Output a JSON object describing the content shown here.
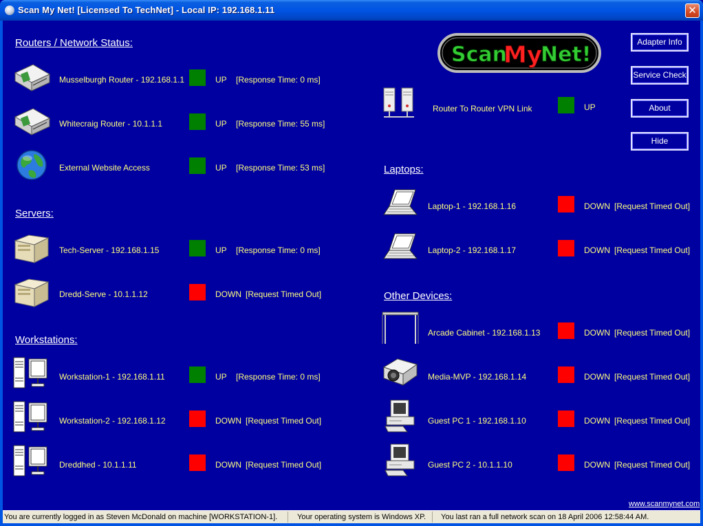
{
  "window": {
    "title": "Scan My Net! [Licensed To TechNet] - Local IP: 192.168.1.11",
    "close_label": "✕"
  },
  "logo": {
    "text": "Scan My Net!"
  },
  "buttons": {
    "adapter_info": "Adapter Info",
    "service_check": "Service Check",
    "about": "About",
    "hide": "Hide"
  },
  "sections": {
    "routers": "Routers / Network Status:",
    "servers": "Servers:",
    "workstations": "Workstations:",
    "laptops": "Laptops:",
    "other": "Other Devices:"
  },
  "devices": {
    "router1": {
      "label": "Musselburgh Router - 192.168.1.1",
      "status": "UP",
      "detail": "[Response Time: 0 ms]",
      "icon": "router-icon"
    },
    "router2": {
      "label": "Whitecraig Router - 10.1.1.1",
      "status": "UP",
      "detail": "[Response Time: 55 ms]",
      "icon": "router-icon"
    },
    "website": {
      "label": "External Website Access",
      "status": "UP",
      "detail": "[Response Time: 53 ms]",
      "icon": "globe-icon"
    },
    "vpn": {
      "label": "Router To Router VPN Link",
      "status": "UP",
      "detail": "",
      "icon": "vpn-servers-icon"
    },
    "server1": {
      "label": "Tech-Server - 192.168.1.15",
      "status": "UP",
      "detail": "[Response Time: 0 ms]",
      "icon": "server-icon"
    },
    "server2": {
      "label": "Dredd-Serve - 10.1.1.12",
      "status": "DOWN",
      "detail": "[Request Timed Out]",
      "icon": "server-icon"
    },
    "ws1": {
      "label": "Workstation-1 - 192.168.1.11",
      "status": "UP",
      "detail": "[Response Time: 0 ms]",
      "icon": "workstation-icon"
    },
    "ws2": {
      "label": "Workstation-2 - 192.168.1.12",
      "status": "DOWN",
      "detail": "[Request Timed Out]",
      "icon": "workstation-icon"
    },
    "ws3": {
      "label": "Dreddhed - 10.1.1.11",
      "status": "DOWN",
      "detail": "[Request Timed Out]",
      "icon": "workstation-icon"
    },
    "laptop1": {
      "label": "Laptop-1 - 192.168.1.16",
      "status": "DOWN",
      "detail": "[Request Timed Out]",
      "icon": "laptop-icon"
    },
    "laptop2": {
      "label": "Laptop-2 - 192.168.1.17",
      "status": "DOWN",
      "detail": "[Request Timed Out]",
      "icon": "laptop-icon"
    },
    "arcade": {
      "label": "Arcade Cabinet - 192.168.1.13",
      "status": "DOWN",
      "detail": "[Request Timed Out]",
      "icon": "arcade-cabinet-icon"
    },
    "media": {
      "label": "Media-MVP - 192.168.1.14",
      "status": "DOWN",
      "detail": "[Request Timed Out]",
      "icon": "projector-icon"
    },
    "guest1": {
      "label": "Guest PC 1 - 192.168.1.10",
      "status": "DOWN",
      "detail": "[Request Timed Out]",
      "icon": "desktop-pc-icon"
    },
    "guest2": {
      "label": "Guest PC 2 - 10.1.1.10",
      "status": "DOWN",
      "detail": "[Request Timed Out]",
      "icon": "desktop-pc-icon"
    }
  },
  "colors": {
    "background": "#0000a0",
    "up": "#008000",
    "down": "#ff0000",
    "label": "#ffff80"
  },
  "website_link": "www.scanmynet.com",
  "statusbar": {
    "user": "You are currently logged in as Steven McDonald on machine [WORKSTATION-1].",
    "os": "Your operating system is Windows XP.",
    "scan": "You last ran a full network scan on 18 April 2006 12:58:44 AM."
  }
}
